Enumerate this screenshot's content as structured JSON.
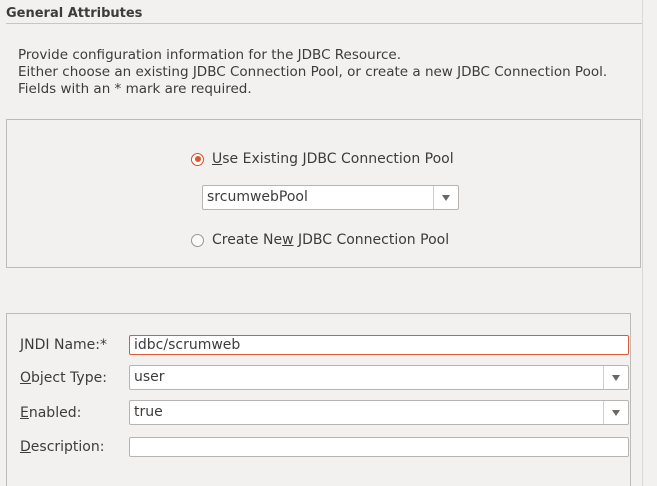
{
  "section": {
    "title": "General Attributes"
  },
  "intro": {
    "line1": "Provide configuration information for the JDBC Resource.",
    "line2": "Either choose an existing JDBC Connection Pool, or create a new JDBC Connection Pool.",
    "line3": "Fields with an * mark are required."
  },
  "pool": {
    "use_existing": {
      "mnemonic": "U",
      "rest": "se Existing JDBC Connection Pool",
      "checked": true
    },
    "selected_pool": "srcumwebPool",
    "create_new": {
      "before": "Create Ne",
      "mnemonic": "w",
      "after": " JDBC Connection Pool",
      "checked": false
    }
  },
  "attributes": {
    "jndi": {
      "mnemonic": "J",
      "rest": "NDI Name:*",
      "value": "idbc/scrumweb"
    },
    "object_type": {
      "mnemonic": "O",
      "rest": "bject Type:",
      "value": "user"
    },
    "enabled": {
      "mnemonic": "E",
      "rest": "nabled:",
      "value": "true"
    },
    "description": {
      "mnemonic": "D",
      "rest": "escription:",
      "value": ""
    }
  },
  "colors": {
    "accent": "#e0552f",
    "background": "#f2f1f0",
    "text": "#3c3c3c"
  },
  "icons": {
    "dropdown": "chevron-down-icon"
  }
}
